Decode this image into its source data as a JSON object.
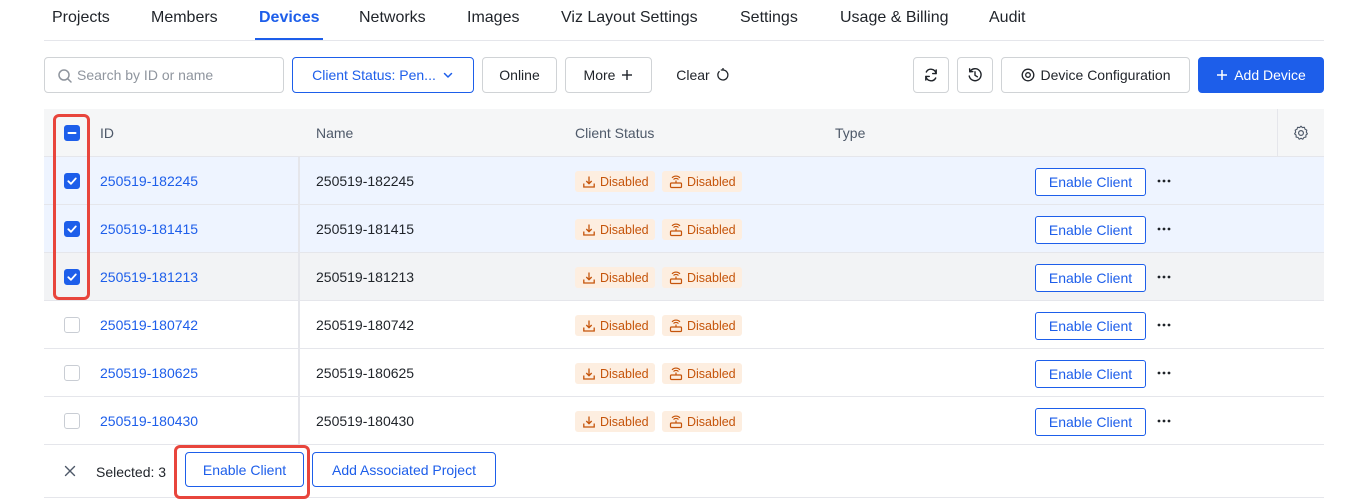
{
  "tabs": [
    {
      "label": "Projects"
    },
    {
      "label": "Members"
    },
    {
      "label": "Devices",
      "active": true
    },
    {
      "label": "Networks"
    },
    {
      "label": "Images"
    },
    {
      "label": "Viz Layout Settings"
    },
    {
      "label": "Settings"
    },
    {
      "label": "Usage & Billing"
    },
    {
      "label": "Audit"
    }
  ],
  "toolbar": {
    "search_placeholder": "Search by ID or name",
    "search_value": "",
    "client_status_filter": "Client Status: Pen...",
    "online_filter": "Online",
    "more_label": "More",
    "clear_label": "Clear",
    "device_configuration_label": "Device Configuration",
    "add_device_label": "Add Device"
  },
  "table": {
    "columns": {
      "id": "ID",
      "name": "Name",
      "client_status": "Client Status",
      "type": "Type"
    },
    "rows": [
      {
        "id": "250519-182245",
        "name": "250519-182245",
        "status1": "Disabled",
        "status2": "Disabled",
        "action": "Enable Client",
        "checked": true
      },
      {
        "id": "250519-181415",
        "name": "250519-181415",
        "status1": "Disabled",
        "status2": "Disabled",
        "action": "Enable Client",
        "checked": true
      },
      {
        "id": "250519-181213",
        "name": "250519-181213",
        "status1": "Disabled",
        "status2": "Disabled",
        "action": "Enable Client",
        "checked": true
      },
      {
        "id": "250519-180742",
        "name": "250519-180742",
        "status1": "Disabled",
        "status2": "Disabled",
        "action": "Enable Client",
        "checked": false
      },
      {
        "id": "250519-180625",
        "name": "250519-180625",
        "status1": "Disabled",
        "status2": "Disabled",
        "action": "Enable Client",
        "checked": false
      },
      {
        "id": "250519-180430",
        "name": "250519-180430",
        "status1": "Disabled",
        "status2": "Disabled",
        "action": "Enable Client",
        "checked": false
      }
    ]
  },
  "footer": {
    "selected_text": "Selected: 3",
    "enable_client_label": "Enable Client",
    "add_associated_project_label": "Add Associated Project"
  },
  "colors": {
    "accent": "#1d5eea",
    "status_tag_bg": "#fdeee0",
    "status_tag_text": "#c5540a",
    "highlight": "#e8453c"
  },
  "icons": {
    "search": "search-icon",
    "chevron": "chevron-down-icon",
    "plus": "plus-icon",
    "reset": "reset-icon",
    "refresh": "refresh-icon",
    "history": "history-icon",
    "config": "config-icon",
    "gear": "gear-icon",
    "download": "download-icon",
    "router": "router-icon",
    "more": "more-icon",
    "close": "close-icon"
  }
}
